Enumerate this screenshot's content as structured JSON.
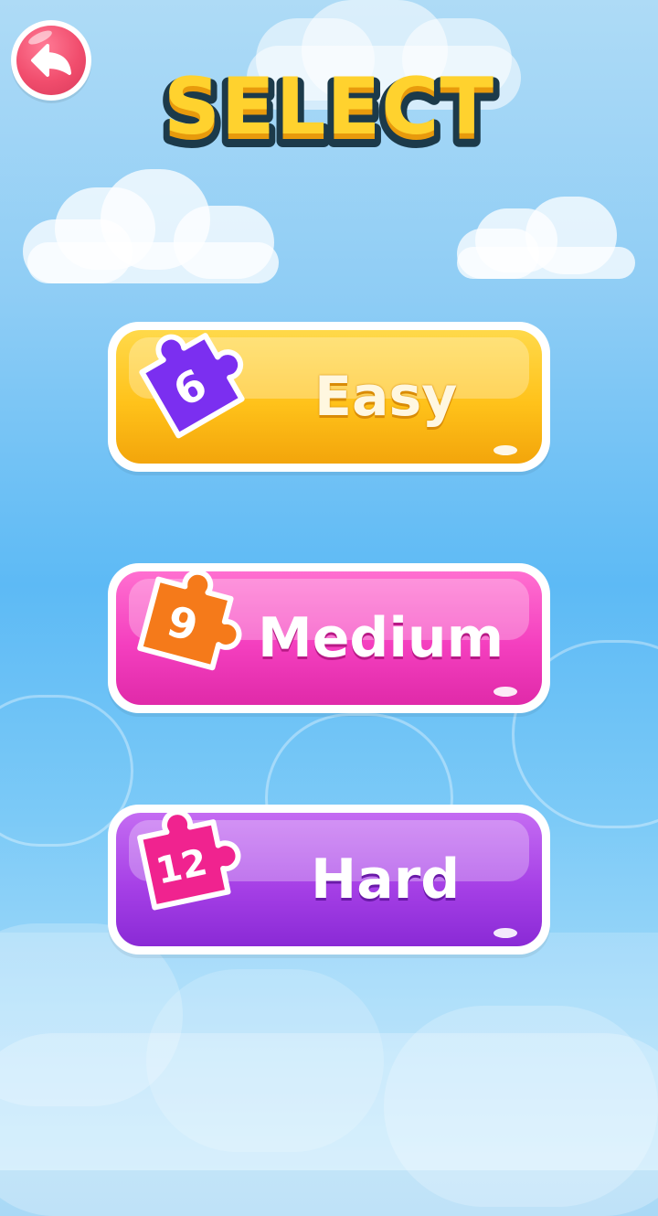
{
  "title": "SELECT",
  "back_button": {
    "icon": "arrow-left-icon"
  },
  "levels": [
    {
      "label": "Easy",
      "pieces": "6",
      "button_color": "#ffc21a",
      "piece_color": "#7b2ff0"
    },
    {
      "label": "Medium",
      "pieces": "9",
      "button_color": "#f43fbf",
      "piece_color": "#f57a1a"
    },
    {
      "label": "Hard",
      "pieces": "12",
      "button_color": "#a640e6",
      "piece_color": "#f0238f"
    }
  ],
  "colors": {
    "title_fill": "#ffd22e",
    "title_outline": "#1c3a4a",
    "back_button": "#f14d6d",
    "sky": "#5dbaf5"
  }
}
